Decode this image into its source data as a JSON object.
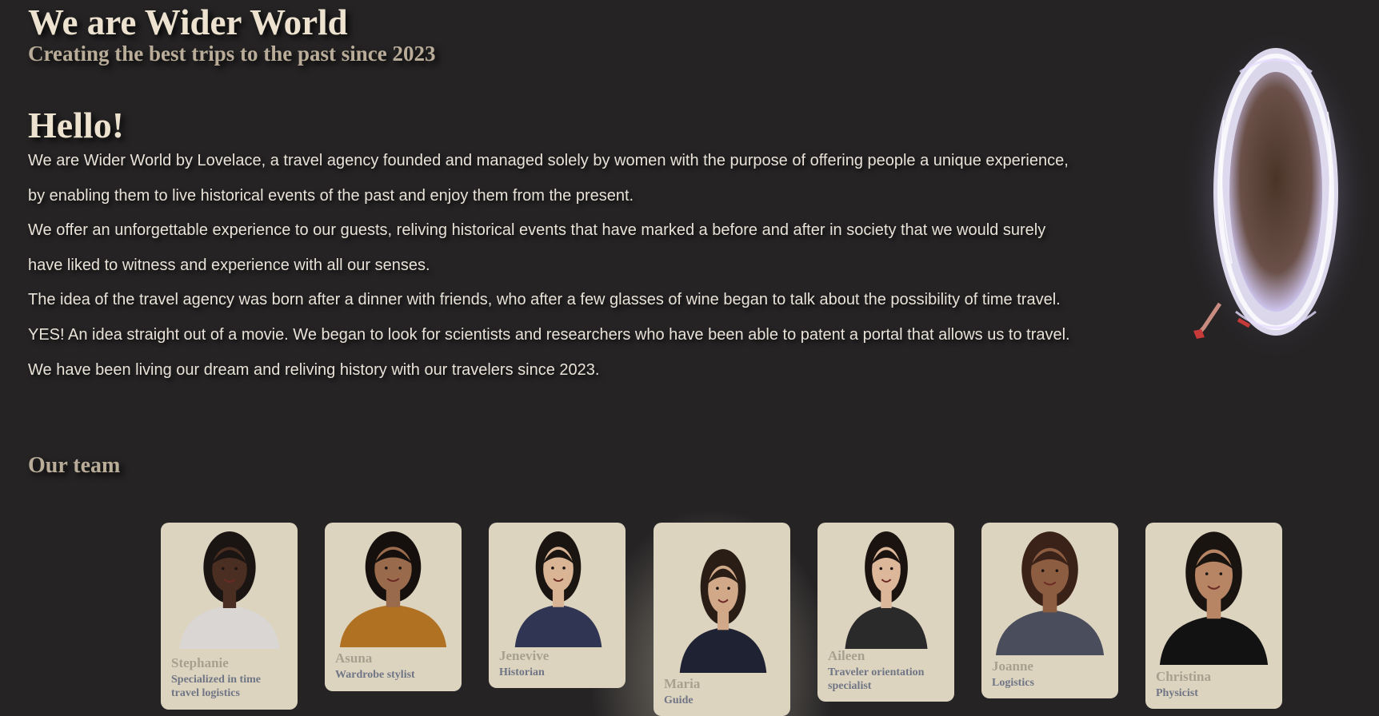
{
  "header": {
    "title": "We are Wider World",
    "subtitle": "Creating the best trips to the past since 2023"
  },
  "about": {
    "heading": "Hello!",
    "lines": [
      "We are Wider World by Lovelace, a travel agency founded and managed solely by women with the purpose of offering people a unique experience,",
      "by enabling them to live historical events of the past and enjoy them from the present.",
      "We offer an unforgettable experience to our guests, reliving historical events that have marked a before and after in society that we would surely",
      "have liked to witness and experience with all our senses.",
      "The idea of the travel agency was born after a dinner with friends, who after a few glasses of wine began to talk about the possibility of time travel.",
      "YES! An idea straight out of a movie. We began to look for scientists and researchers who have been able to patent a portal that allows us to travel.",
      "We have been living our dream and reliving history with our travelers since 2023."
    ]
  },
  "team": {
    "heading": "Our team",
    "members": [
      {
        "name": "Stephanie",
        "role": "Specialized in time travel logistics",
        "skin": "#4a2e22",
        "hair": "#1a1412",
        "top": "#d9d6d3"
      },
      {
        "name": "Asuna",
        "role": "Wardrobe stylist",
        "skin": "#9a6a4c",
        "hair": "#15100d",
        "top": "#b07222"
      },
      {
        "name": "Jenevive",
        "role": "Historian",
        "skin": "#d9b595",
        "hair": "#1b1512",
        "top": "#2f3552"
      },
      {
        "name": "Maria",
        "role": "Guide",
        "skin": "#d1a888",
        "hair": "#2a1d16",
        "top": "#1e2233"
      },
      {
        "name": "Aileen",
        "role": "Traveler orientation specialist",
        "skin": "#dcb79a",
        "hair": "#1a1310",
        "top": "#2a2a2a"
      },
      {
        "name": "Joanne",
        "role": "Logistics",
        "skin": "#8d5d42",
        "hair": "#3b2219",
        "top": "#4a4d5c"
      },
      {
        "name": "Christina",
        "role": "Physicist",
        "skin": "#b78563",
        "hair": "#1a1411",
        "top": "#121212"
      }
    ]
  },
  "colors": {
    "background": "#252324",
    "card": "#ddd4c0",
    "heading": "#ece2cf",
    "muted_heading": "#b9ad99",
    "member_role": "#6f7585"
  },
  "icons": [
    "time-portal-illustration"
  ]
}
